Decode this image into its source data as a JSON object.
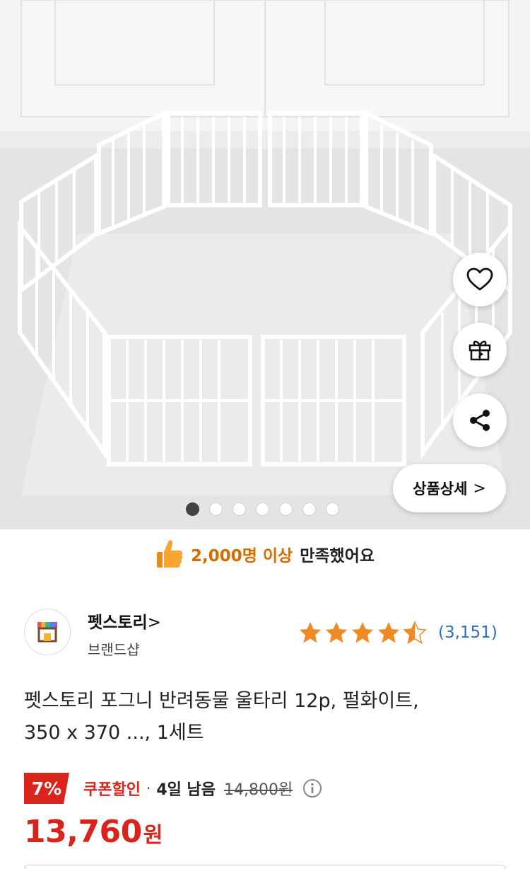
{
  "hero": {
    "image_alt": "white pet fence product photo",
    "carousel_total": 7,
    "carousel_active": 1,
    "detail_button_label": "상품상세",
    "detail_button_chevron": ">",
    "icons": {
      "like": "heart-icon",
      "gift": "gift-icon",
      "share": "share-icon"
    }
  },
  "satisfaction": {
    "icon": "thumbs-up-icon",
    "highlight": "2,000명 이상",
    "text": "만족했어요"
  },
  "seller": {
    "name": "펫스토리",
    "arrow": ">",
    "type": "브랜드샵",
    "rating": 4.5,
    "review_count": "(3,151)"
  },
  "product": {
    "title_line1": "펫스토리 포그니 반려동물 울타리 12p, 펄화이트,",
    "title_line2": "350 x 370 ..., 1세트"
  },
  "price": {
    "discount_badge": "7%",
    "coupon_label": "쿠폰할인",
    "separator": "·",
    "days_left": "4일 남음",
    "original_price": "14,800원",
    "final_price": "13,760",
    "currency": "원"
  },
  "colors": {
    "accent_red": "#d9241c",
    "highlight_orange": "#d86b00",
    "star_orange": "#f08a24",
    "review_blue": "#2f6ec8"
  }
}
